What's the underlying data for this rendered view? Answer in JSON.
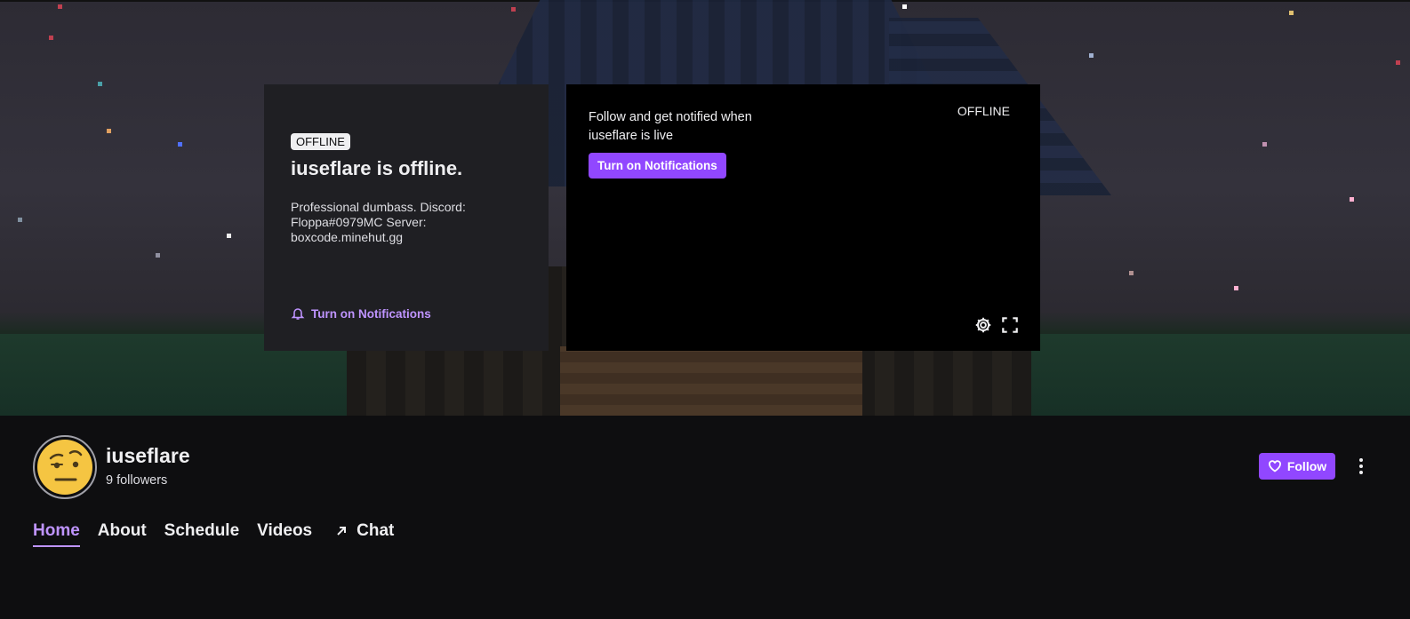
{
  "colors": {
    "accent": "#9147ff",
    "accent_text": "#bf94ff",
    "background": "#0e0e10",
    "panel": "#1f1f23"
  },
  "offline_card": {
    "badge": "OFFLINE",
    "title": "iuseflare is offline.",
    "bio": "Professional dumbass. Discord: Floppa#0979MC Server: boxcode.minehut.gg",
    "notifications_link": "Turn on Notifications"
  },
  "player": {
    "prompt": "Follow and get notified when iuseflare is live",
    "notifications_button": "Turn on Notifications",
    "status": "OFFLINE",
    "icons": [
      "gear-icon",
      "fullscreen-icon"
    ]
  },
  "channel": {
    "name": "iuseflare",
    "followers": "9 followers",
    "follow_button": "Follow"
  },
  "tabs": [
    {
      "label": "Home",
      "active": true
    },
    {
      "label": "About",
      "active": false
    },
    {
      "label": "Schedule",
      "active": false
    },
    {
      "label": "Videos",
      "active": false
    },
    {
      "label": "Chat",
      "active": false,
      "icon": "external-arrow-icon"
    }
  ]
}
